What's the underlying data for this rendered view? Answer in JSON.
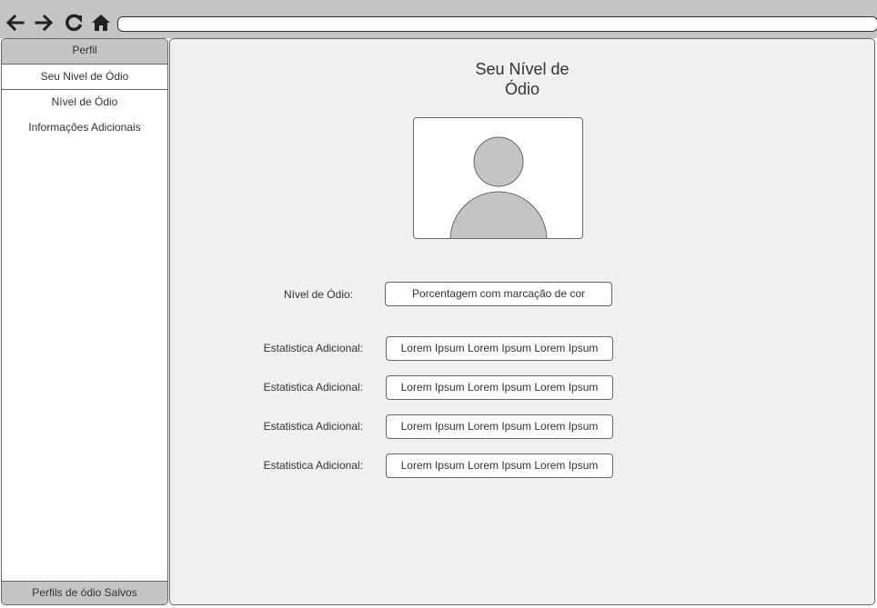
{
  "browser": {
    "address": "",
    "icons": [
      "back-arrow-icon",
      "forward-arrow-icon",
      "reload-icon",
      "home-icon"
    ]
  },
  "sidebar": {
    "header": "Perfil",
    "items": [
      {
        "label": "Seu Nivel de Ódio",
        "active": true
      },
      {
        "label": "Nível de Ódio",
        "active": false
      },
      {
        "label": "Informações Adicionais",
        "active": false
      }
    ],
    "footer": "Perfils de ódio Salvos"
  },
  "main": {
    "title_line1": "Seu Nível de",
    "title_line2": "Ódio",
    "hate_level": {
      "label": "Nível de Ódio:",
      "value": "Porcentagem com marcação de cor"
    },
    "stats": [
      {
        "label": "Estatistica Adicional:",
        "value": "Lorem Ipsum Lorem Ipsum Lorem Ipsum"
      },
      {
        "label": "Estatistica Adicional:",
        "value": "Lorem Ipsum Lorem Ipsum Lorem Ipsum"
      },
      {
        "label": "Estatistica Adicional:",
        "value": "Lorem Ipsum Lorem Ipsum Lorem Ipsum"
      },
      {
        "label": "Estatistica Adicional:",
        "value": "Lorem Ipsum Lorem Ipsum Lorem Ipsum"
      }
    ]
  },
  "colors": {
    "chrome": "#c4c4c4",
    "main_bg": "#eff0ef",
    "avatar_fill": "#c4c4c4",
    "border": "#666666"
  }
}
